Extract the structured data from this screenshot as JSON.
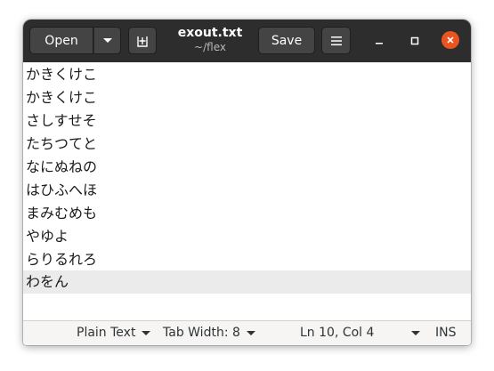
{
  "header": {
    "open_label": "Open",
    "save_label": "Save",
    "title": "exout.txt",
    "subtitle": "~/flex"
  },
  "editor": {
    "lines": [
      "かきくけこ",
      "かきくけこ",
      "さしすせそ",
      "たちつてと",
      "なにぬねの",
      "はひふへほ",
      "まみむめも",
      "やゆよ",
      "らりるれろ",
      "わをん"
    ],
    "current_line": 10
  },
  "statusbar": {
    "language": "Plain Text",
    "tab_width": "Tab Width: 8",
    "position": "Ln 10, Col 4",
    "mode": "INS"
  },
  "colors": {
    "headerbar": "#2d2d2d",
    "button": "#444444",
    "close": "#e95420",
    "current_line": "#ebebeb"
  },
  "icons": [
    "chevron-down-icon",
    "new-tab-icon",
    "hamburger-menu-icon",
    "minimize-icon",
    "maximize-icon",
    "close-icon"
  ]
}
